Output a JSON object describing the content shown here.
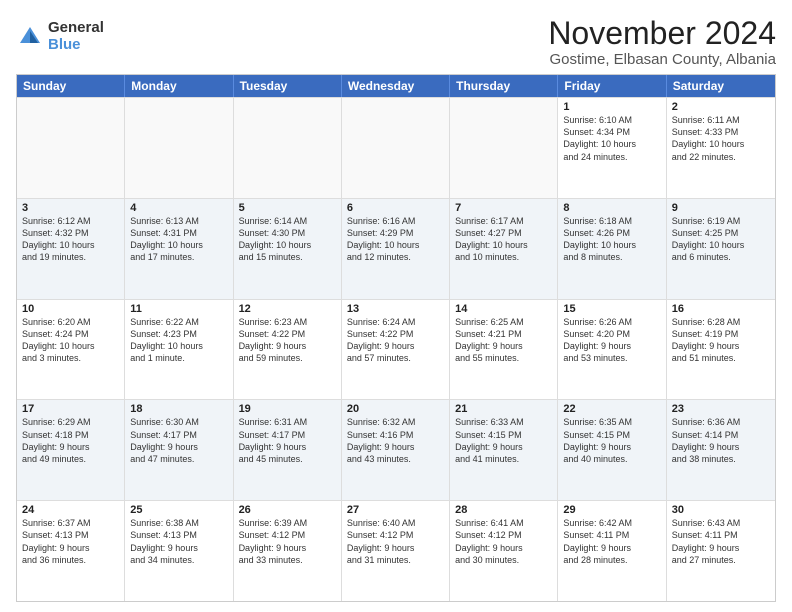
{
  "logo": {
    "general": "General",
    "blue": "Blue"
  },
  "title": "November 2024",
  "subtitle": "Gostime, Elbasan County, Albania",
  "days": [
    "Sunday",
    "Monday",
    "Tuesday",
    "Wednesday",
    "Thursday",
    "Friday",
    "Saturday"
  ],
  "rows": [
    [
      {
        "day": "",
        "text": ""
      },
      {
        "day": "",
        "text": ""
      },
      {
        "day": "",
        "text": ""
      },
      {
        "day": "",
        "text": ""
      },
      {
        "day": "",
        "text": ""
      },
      {
        "day": "1",
        "text": "Sunrise: 6:10 AM\nSunset: 4:34 PM\nDaylight: 10 hours\nand 24 minutes."
      },
      {
        "day": "2",
        "text": "Sunrise: 6:11 AM\nSunset: 4:33 PM\nDaylight: 10 hours\nand 22 minutes."
      }
    ],
    [
      {
        "day": "3",
        "text": "Sunrise: 6:12 AM\nSunset: 4:32 PM\nDaylight: 10 hours\nand 19 minutes."
      },
      {
        "day": "4",
        "text": "Sunrise: 6:13 AM\nSunset: 4:31 PM\nDaylight: 10 hours\nand 17 minutes."
      },
      {
        "day": "5",
        "text": "Sunrise: 6:14 AM\nSunset: 4:30 PM\nDaylight: 10 hours\nand 15 minutes."
      },
      {
        "day": "6",
        "text": "Sunrise: 6:16 AM\nSunset: 4:29 PM\nDaylight: 10 hours\nand 12 minutes."
      },
      {
        "day": "7",
        "text": "Sunrise: 6:17 AM\nSunset: 4:27 PM\nDaylight: 10 hours\nand 10 minutes."
      },
      {
        "day": "8",
        "text": "Sunrise: 6:18 AM\nSunset: 4:26 PM\nDaylight: 10 hours\nand 8 minutes."
      },
      {
        "day": "9",
        "text": "Sunrise: 6:19 AM\nSunset: 4:25 PM\nDaylight: 10 hours\nand 6 minutes."
      }
    ],
    [
      {
        "day": "10",
        "text": "Sunrise: 6:20 AM\nSunset: 4:24 PM\nDaylight: 10 hours\nand 3 minutes."
      },
      {
        "day": "11",
        "text": "Sunrise: 6:22 AM\nSunset: 4:23 PM\nDaylight: 10 hours\nand 1 minute."
      },
      {
        "day": "12",
        "text": "Sunrise: 6:23 AM\nSunset: 4:22 PM\nDaylight: 9 hours\nand 59 minutes."
      },
      {
        "day": "13",
        "text": "Sunrise: 6:24 AM\nSunset: 4:22 PM\nDaylight: 9 hours\nand 57 minutes."
      },
      {
        "day": "14",
        "text": "Sunrise: 6:25 AM\nSunset: 4:21 PM\nDaylight: 9 hours\nand 55 minutes."
      },
      {
        "day": "15",
        "text": "Sunrise: 6:26 AM\nSunset: 4:20 PM\nDaylight: 9 hours\nand 53 minutes."
      },
      {
        "day": "16",
        "text": "Sunrise: 6:28 AM\nSunset: 4:19 PM\nDaylight: 9 hours\nand 51 minutes."
      }
    ],
    [
      {
        "day": "17",
        "text": "Sunrise: 6:29 AM\nSunset: 4:18 PM\nDaylight: 9 hours\nand 49 minutes."
      },
      {
        "day": "18",
        "text": "Sunrise: 6:30 AM\nSunset: 4:17 PM\nDaylight: 9 hours\nand 47 minutes."
      },
      {
        "day": "19",
        "text": "Sunrise: 6:31 AM\nSunset: 4:17 PM\nDaylight: 9 hours\nand 45 minutes."
      },
      {
        "day": "20",
        "text": "Sunrise: 6:32 AM\nSunset: 4:16 PM\nDaylight: 9 hours\nand 43 minutes."
      },
      {
        "day": "21",
        "text": "Sunrise: 6:33 AM\nSunset: 4:15 PM\nDaylight: 9 hours\nand 41 minutes."
      },
      {
        "day": "22",
        "text": "Sunrise: 6:35 AM\nSunset: 4:15 PM\nDaylight: 9 hours\nand 40 minutes."
      },
      {
        "day": "23",
        "text": "Sunrise: 6:36 AM\nSunset: 4:14 PM\nDaylight: 9 hours\nand 38 minutes."
      }
    ],
    [
      {
        "day": "24",
        "text": "Sunrise: 6:37 AM\nSunset: 4:13 PM\nDaylight: 9 hours\nand 36 minutes."
      },
      {
        "day": "25",
        "text": "Sunrise: 6:38 AM\nSunset: 4:13 PM\nDaylight: 9 hours\nand 34 minutes."
      },
      {
        "day": "26",
        "text": "Sunrise: 6:39 AM\nSunset: 4:12 PM\nDaylight: 9 hours\nand 33 minutes."
      },
      {
        "day": "27",
        "text": "Sunrise: 6:40 AM\nSunset: 4:12 PM\nDaylight: 9 hours\nand 31 minutes."
      },
      {
        "day": "28",
        "text": "Sunrise: 6:41 AM\nSunset: 4:12 PM\nDaylight: 9 hours\nand 30 minutes."
      },
      {
        "day": "29",
        "text": "Sunrise: 6:42 AM\nSunset: 4:11 PM\nDaylight: 9 hours\nand 28 minutes."
      },
      {
        "day": "30",
        "text": "Sunrise: 6:43 AM\nSunset: 4:11 PM\nDaylight: 9 hours\nand 27 minutes."
      }
    ]
  ]
}
